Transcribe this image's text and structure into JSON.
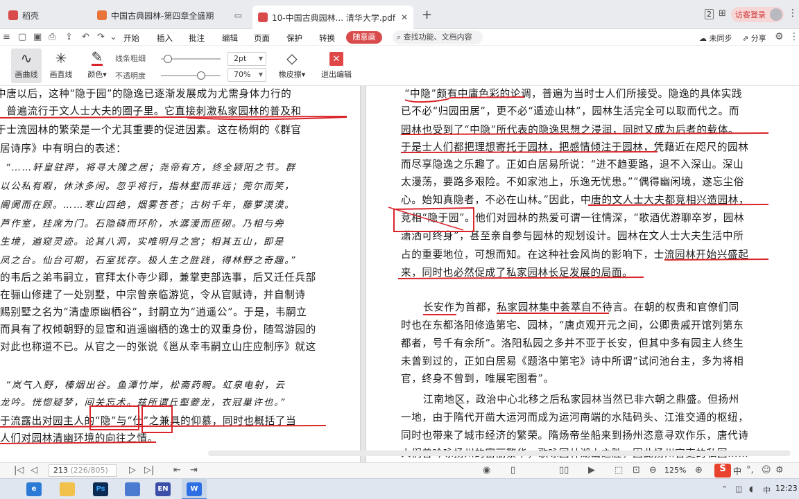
{
  "tabs": [
    {
      "label": "稻壳",
      "icon": "docer-icon"
    },
    {
      "label": "中国古典园林-第四章全盛期",
      "icon": "presentation-icon"
    },
    {
      "label": "10-中国古典园林... 清华大学.pdf",
      "icon": "pdf-icon"
    }
  ],
  "tabbar": {
    "add_tab": "+",
    "counter": "2",
    "login_label": "访客登录"
  },
  "menu": {
    "items": [
      "开始",
      "插入",
      "批注",
      "编辑",
      "页面",
      "保护",
      "转换"
    ],
    "active_item": "随意画",
    "search_placeholder": "查找功能、文档内容",
    "sync_label": "未同步",
    "share_label": "分享"
  },
  "toolbar": {
    "draw_curve": "画曲线",
    "draw_line": "画直线",
    "color_label": "颜色",
    "thickness_label": "线条粗细",
    "thickness_value": "2pt",
    "opacity_label": "不透明度",
    "opacity_value": "70%",
    "eraser_label": "橡皮擦",
    "exit_label": "退出编辑",
    "thickness_fraction": 0.05,
    "opacity_fraction": 0.7,
    "accent_color": "#d94a4a",
    "ink_color": "#d9242a"
  },
  "document": {
    "left_lines": [
      "中唐以后，这种“隐于园”的隐逸已逐渐发展成为尤需身体力行的",
      "，普遍流行于文人士大夫的圈子里。它直接刺激私家园林的普及和",
      "于士流园林的繁荣是一个尤其重要的促进因素。这在杨炯的《群官",
      "居诗序》中有明白的表述：",
      "“……轩皇驻跸，将寻大隗之居；尧帝有方，终全颍阳之节。群",
      "以公私有暇，休沐多闲。忽乎将行，指林壑而非远；莞尔而笑，",
      "阛阓而在顾。……寒山四绝，烟雾苍苍；古树千年，藤萝漠漠。",
      "芦作室，挂席为门。石隐磷而环阶，水潺湲而匝砌。乃相与旁",
      "生境，遍窥灵迹。论其八洞，实唯明月之宫；相其五山，即是",
      "凤之台。仙台可期，石室犹存。极人生之胜践，得林野之奇趣。”",
      "的韦后之弟韦嗣立，官拜太仆寺少卿，兼掌吏部选事，后又迁任兵部",
      "在骊山修建了一处别墅，中宗曾亲临游览，令从官赋诗，并自制诗",
      "赐别墅之名为“清虚原幽栖谷”，封嗣立为“逍遥公”。于是，韦嗣立",
      "而具有了权倾朝野的显宦和逍遥幽栖的逸士的双重身份，随驾游园的",
      "对此也称道不已。从官之一的张说《邕从幸韦嗣立山庄应制序》就这",
      "“岚气入野，榛烟出谷。鱼潭竹岸，松斋药畹。虹泉电射，云",
      "龙吟。恍惚疑梦，间关忘术。兹所谓丘壑夔龙，衣冠巢许也。”",
      "于流露出对园主人的“隐”与“仕”之兼具的仰慕，同时也概括了当",
      "人们对园林清幽环境的向往之情。"
    ],
    "right_lines": [
      "“中隐”颇有中庸色彩的论调，普遍为当时士人们所接受。隐逸的具体实践",
      "已不必“归园田居”，更不必“遁迹山林”，园林生活完全可以取而代之。而",
      "园林也受到了“中隐”所代表的隐逸思想之浸润，同时又成为后者的载体。",
      "于是士人们都把理想寄托于园林，把感情倾注于园林，凭藉近在咫尺的园林",
      "而尽享隐逸之乐趣了。正如白居易所说：“进不趋要路，退不入深山。深山",
      "太漫荡，要路多艰险。不如家池上，乐逸无忧患。”“偶得幽闲境，遂忘尘俗",
      "心。始知真隐者，不必在山林。”因此，中唐的文人士大夫都竞相兴造园林，",
      "竞相“隐于园”。他们对园林的热爱可谓一往情深，“歌酒优游聊卒岁，园林",
      "潇洒可终身”，甚至亲自参与园林的规划设计。园林在文人士大夫生活中所",
      "占的重要地位，可想而知。在这种社会风尚的影响下，士流园林开始兴盛起",
      "来，同时也必然促成了私家园林长足发展的局面。",
      "长安作为首都，私家园林集中荟萃自不待言。在朝的权贵和官僚们同",
      "时也在东都洛阳修造第宅、园林，“唐贞观开元之间，公卿贵戚开馆列第东",
      "都者，号千有余所”。洛阳私园之多并不亚于长安，但其中多有园主人终生",
      "未曾到过的，正如白居易《题洛中第宅》诗中所谓“试问池台主，多为将相",
      "官，终身不曾到，唯展宅图看”。",
      "江南地区，政治中心北移之后私家园林当然已非六朝之鼎盛。但扬州",
      "一地，由于隋代开凿大运河而成为运河南端的水陆码头、江淮交通的枢纽，",
      "同时也带来了城市经济的繁荣。隋炀帝坐船来到扬州恣意寻欢作乐，唐代诗",
      "人们曾吟咏扬州的富丽繁华，歌咏园林湖山之胜，因此扬州官吏的私园……"
    ]
  },
  "statusbar": {
    "current_page": "213",
    "page_total": "(226/805)",
    "zoom": "125%",
    "ime_label": "S",
    "ime_mode": "中"
  },
  "taskbar": {
    "apps": [
      {
        "icon": "edge-icon",
        "label": "e"
      },
      {
        "icon": "folder-icon",
        "label": ""
      },
      {
        "icon": "photoshop-icon",
        "label": "Ps"
      },
      {
        "icon": "store-icon",
        "label": ""
      },
      {
        "icon": "en-app-icon",
        "label": "EN"
      },
      {
        "icon": "wps-icon",
        "label": "W"
      }
    ],
    "time": "12:23"
  }
}
